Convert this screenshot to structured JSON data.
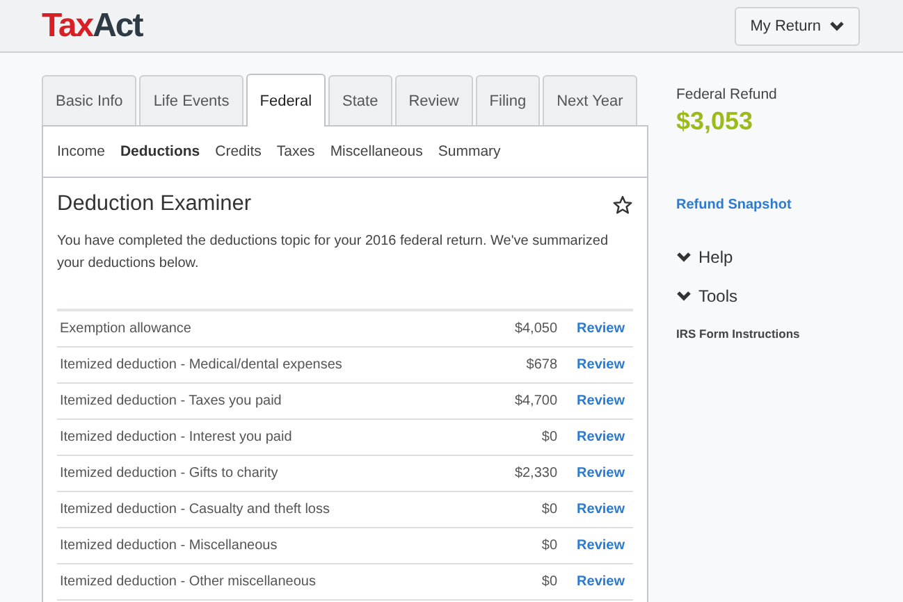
{
  "header": {
    "logo": [
      "Tax",
      "Act"
    ],
    "menu_button": "My Return"
  },
  "tabs": [
    {
      "label": "Basic Info",
      "selected": false
    },
    {
      "label": "Life Events",
      "selected": false
    },
    {
      "label": "Federal",
      "selected": true
    },
    {
      "label": "State",
      "selected": false
    },
    {
      "label": "Review",
      "selected": false
    },
    {
      "label": "Filing",
      "selected": false
    },
    {
      "label": "Next Year",
      "selected": false
    }
  ],
  "subnav": [
    {
      "label": "Income",
      "selected": false
    },
    {
      "label": "Deductions",
      "selected": true
    },
    {
      "label": "Credits",
      "selected": false
    },
    {
      "label": "Taxes",
      "selected": false
    },
    {
      "label": "Miscellaneous",
      "selected": false
    },
    {
      "label": "Summary",
      "selected": false
    }
  ],
  "card": {
    "title": "Deduction Examiner",
    "starred": false,
    "intro": "You have completed the deductions topic for your 2016 federal return. We've summarized your deductions below.",
    "rows": [
      {
        "label": "Exemption allowance",
        "amount": "$4,050",
        "action": "Review"
      },
      {
        "label": "Itemized deduction - Medical/dental expenses",
        "amount": "$678",
        "action": "Review"
      },
      {
        "label": "Itemized deduction - Taxes you paid",
        "amount": "$4,700",
        "action": "Review"
      },
      {
        "label": "Itemized deduction - Interest you paid",
        "amount": "$0",
        "action": "Review"
      },
      {
        "label": "Itemized deduction - Gifts to charity",
        "amount": "$2,330",
        "action": "Review"
      },
      {
        "label": "Itemized deduction - Casualty and theft loss",
        "amount": "$0",
        "action": "Review"
      },
      {
        "label": "Itemized deduction - Miscellaneous",
        "amount": "$0",
        "action": "Review"
      },
      {
        "label": "Itemized deduction - Other miscellaneous",
        "amount": "$0",
        "action": "Review"
      }
    ]
  },
  "sidebar": {
    "refund_label": "Federal Refund",
    "refund_amount": "$3,053",
    "snapshot_link": "Refund Snapshot",
    "sections": [
      {
        "label": "Help",
        "expanded": false
      },
      {
        "label": "Tools",
        "expanded": false
      }
    ],
    "tools_link": "IRS Form Instructions"
  }
}
